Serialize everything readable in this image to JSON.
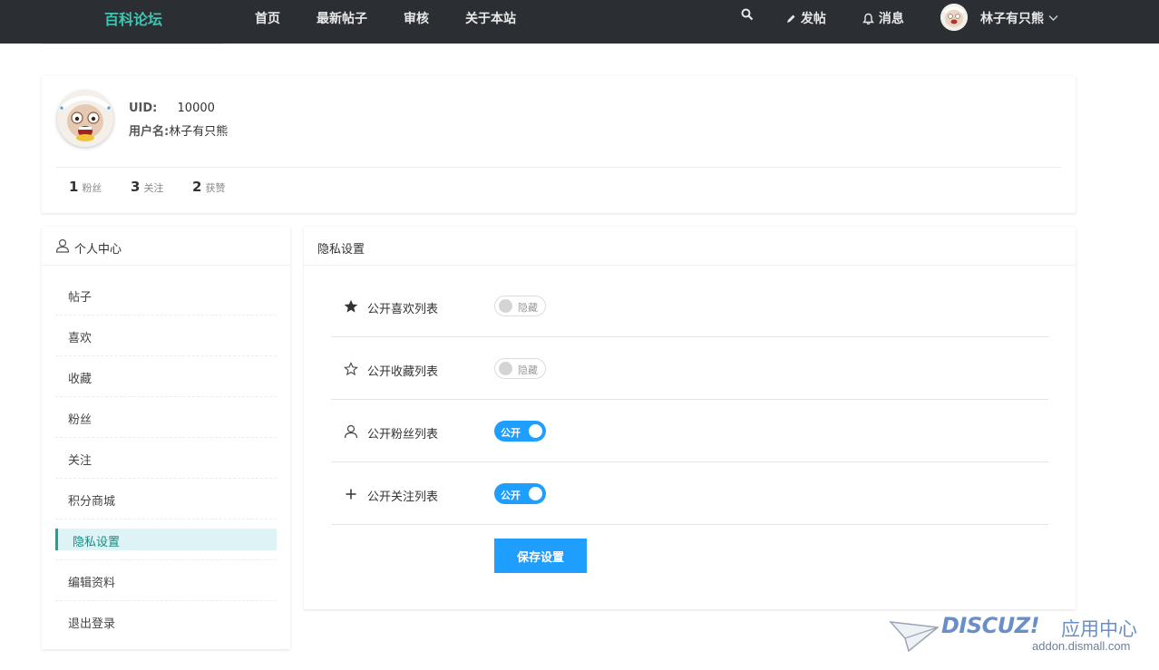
{
  "topbar": {
    "brand": "百科论坛",
    "nav": [
      "首页",
      "最新帖子",
      "审核",
      "关于本站"
    ],
    "post_label": "发帖",
    "messages_label": "消息",
    "user_name": "林子有只熊"
  },
  "profile": {
    "uid_label": "UID:",
    "uid_value": "10000",
    "username_label": "用户名:",
    "username_value": "林子有只熊",
    "stats": [
      {
        "num": "1",
        "label": "粉丝"
      },
      {
        "num": "3",
        "label": "关注"
      },
      {
        "num": "2",
        "label": "获赞"
      }
    ]
  },
  "sidebar": {
    "title": "个人中心",
    "items": [
      {
        "label": "帖子"
      },
      {
        "label": "喜欢"
      },
      {
        "label": "收藏"
      },
      {
        "label": "粉丝"
      },
      {
        "label": "关注"
      },
      {
        "label": "积分商城"
      },
      {
        "label": "隐私设置"
      },
      {
        "label": "编辑资料"
      },
      {
        "label": "退出登录"
      }
    ],
    "active_index": 6
  },
  "panel": {
    "title": "隐私设置",
    "settings": [
      {
        "label": "公开喜欢列表",
        "icon": "star-filled-icon",
        "state": "off",
        "toggle_label": "隐藏"
      },
      {
        "label": "公开收藏列表",
        "icon": "star-outline-icon",
        "state": "off",
        "toggle_label": "隐藏"
      },
      {
        "label": "公开粉丝列表",
        "icon": "user-icon",
        "state": "on",
        "toggle_label": "公开"
      },
      {
        "label": "公开关注列表",
        "icon": "plus-icon",
        "state": "on",
        "toggle_label": "公开"
      }
    ],
    "save_label": "保存设置"
  },
  "watermark": {
    "brand": "DISCUZ!",
    "cn": "应用中心",
    "url": "addon.dismall.com"
  },
  "colors": {
    "topbar_bg": "#2b2e33",
    "brand": "#3fc5b0",
    "accent": "#1e9fff",
    "active_item": "#1aa38f"
  }
}
